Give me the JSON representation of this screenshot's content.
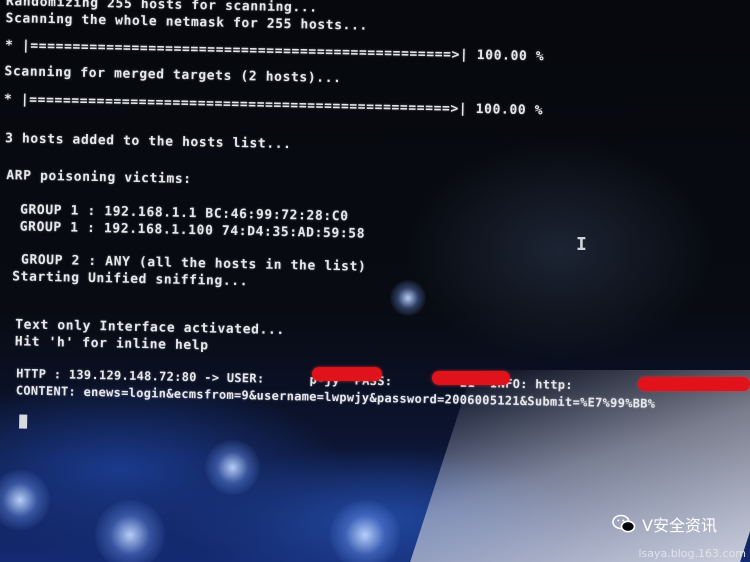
{
  "terminal": {
    "lines": [
      "Randomizing 255 hosts for scanning...",
      "Scanning the whole netmask for 255 hosts...",
      "* |==================================================>| 100.00 %",
      "Scanning for merged targets (2 hosts)...",
      "* |==================================================>| 100.00 %",
      "3 hosts added to the hosts list...",
      "ARP poisoning victims:",
      " GROUP 1 : 192.168.1.1 BC:46:99:72:28:C0",
      " GROUP 1 : 192.168.1.100 74:D4:35:AD:59:58",
      " GROUP 2 : ANY (all the hosts in the list)",
      "Starting Unified sniffing...",
      "Text only Interface activated...",
      "Hit 'h' for inline help",
      "HTTP : 139.129.148.72:80 -> USER:      p-jy  PASS:         21  INFO: http:",
      "CONTENT: enews=login&ecmsfrom=9&username=lwpwjy&password=2006005121&Submit=%E7%99%BB%"
    ]
  },
  "watermark": {
    "name": "V安全资讯",
    "icon": "wechat-icon",
    "site": "lsaya.blog.163.com"
  },
  "colors": {
    "terminal_text": "#e6e8ec",
    "redaction": "#e0121b",
    "background": "#05070c"
  }
}
